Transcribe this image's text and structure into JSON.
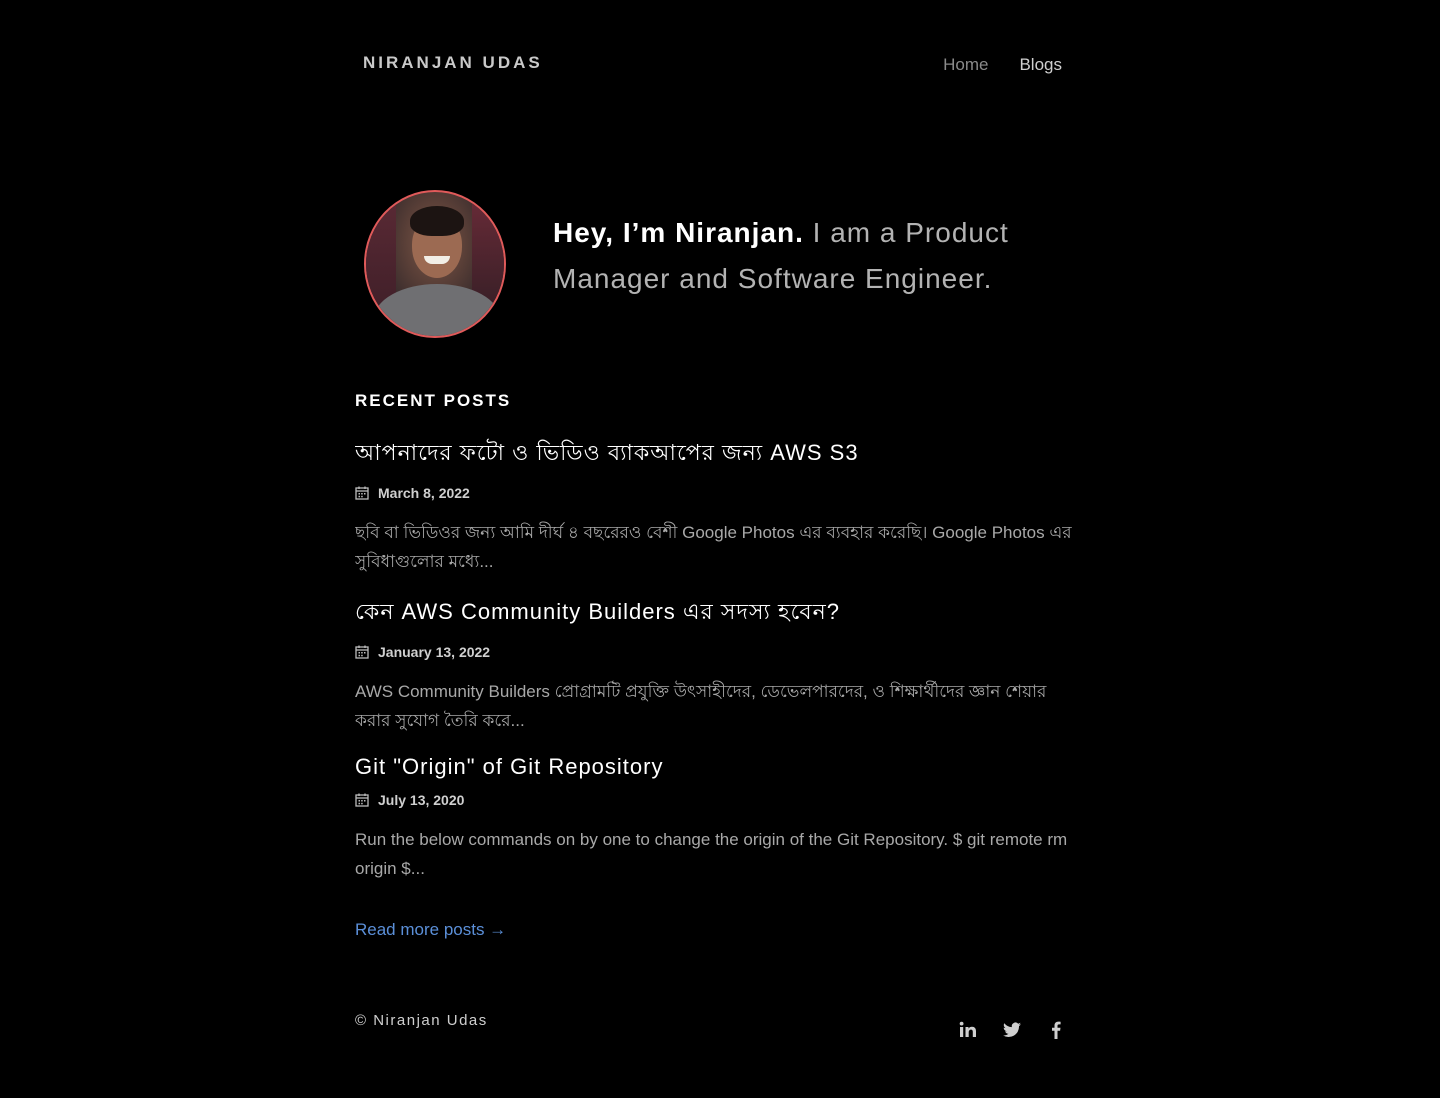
{
  "header": {
    "brand": "NIRANJAN UDAS",
    "nav": [
      {
        "label": "Home"
      },
      {
        "label": "Blogs"
      }
    ]
  },
  "hero": {
    "greeting": "Hey, I’m Niranjan.",
    "tagline": "I am a Product Manager and Software Engineer."
  },
  "recent": {
    "title": "RECENT POSTS",
    "posts": [
      {
        "title": "আপনাদের ফটো ও ভিডিও ব্যাকআপের জন্য AWS S3",
        "date": "March 8, 2022",
        "excerpt": "ছবি বা ভিডিওর জন্য আমি দীর্ঘ ৪ বছরেরও বেশী Google Photos এর ব্যবহার করেছি। Google Photos এর সুবিধাগুলোর মধ্যে..."
      },
      {
        "title": "কেন AWS Community Builders এর সদস্য হবেন?",
        "date": "January 13, 2022",
        "excerpt": "AWS Community Builders প্রোগ্রামটি প্রযুক্তি উৎসাহীদের, ডেভেলপারদের, ও শিক্ষার্থীদের জ্ঞান শেয়ার করার সুযোগ তৈরি করে..."
      },
      {
        "title": "Git \"Origin\" of Git Repository",
        "date": "July 13, 2020",
        "excerpt": "Run the below commands on by one to change the origin of the Git Repository. $ git remote rm origin $..."
      }
    ],
    "read_more": "Read more posts →"
  },
  "footer": {
    "copyright": "© Niranjan Udas",
    "social": [
      "linkedin-icon",
      "twitter-icon",
      "facebook-icon"
    ]
  },
  "colors": {
    "background": "#000000",
    "link": "#5b8fd8",
    "avatar_border": "#e05a5a"
  }
}
